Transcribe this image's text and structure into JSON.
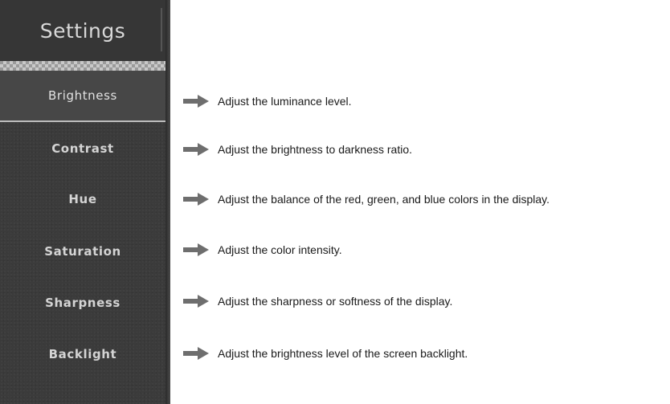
{
  "menu": {
    "title": "Settings",
    "selected_index": 0,
    "items": [
      {
        "label": "Brightness",
        "description": "Adjust the luminance level."
      },
      {
        "label": "Contrast",
        "description": "Adjust the brightness to darkness ratio."
      },
      {
        "label": "Hue",
        "description": "Adjust the balance of the red, green, and blue colors in the display."
      },
      {
        "label": "Saturation",
        "description": "Adjust the color intensity."
      },
      {
        "label": "Sharpness",
        "description": "Adjust the sharpness or softness of the display."
      },
      {
        "label": "Backlight",
        "description": "Adjust the brightness level of the screen backlight."
      }
    ]
  },
  "icons": {
    "description_pointer": "right-arrow-icon"
  },
  "colors": {
    "menu_background": "#3b3b3b",
    "menu_selected": "#474747",
    "menu_text": "#d4d4d4",
    "arrow": "#6e6e6e",
    "description_text": "#1a1a1a"
  }
}
